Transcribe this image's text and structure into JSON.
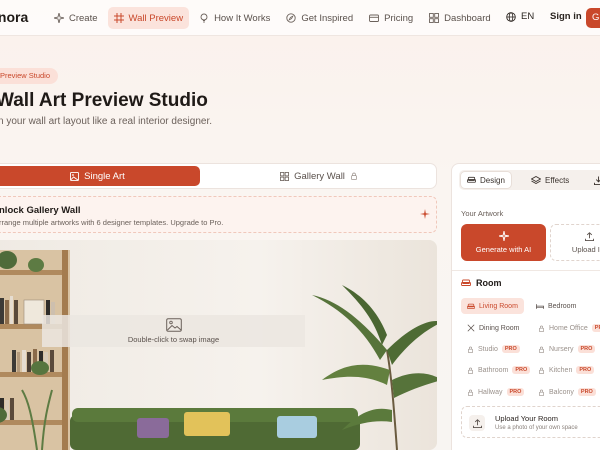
{
  "app": {
    "logo": "Inora"
  },
  "nav": {
    "items": [
      {
        "label": "Create",
        "icon": "sparkle-icon",
        "active": false
      },
      {
        "label": "Wall Preview",
        "icon": "frame-icon",
        "active": true
      },
      {
        "label": "How It Works",
        "icon": "bulb-icon",
        "active": false
      },
      {
        "label": "Get Inspired",
        "icon": "compass-icon",
        "active": false
      },
      {
        "label": "Pricing",
        "icon": "card-icon",
        "active": false
      },
      {
        "label": "Dashboard",
        "icon": "grid-icon",
        "active": false
      }
    ],
    "language": "EN",
    "signin": "Sign in",
    "cta": "G"
  },
  "hero": {
    "badge": "Preview Studio",
    "title": "Wall Art Preview Studio",
    "subtitle": "n your wall art layout like a real interior designer."
  },
  "tabs": {
    "single": "Single Art",
    "gallery": "Gallery Wall"
  },
  "unlock": {
    "title": "nlock Gallery Wall",
    "subtitle": "rrange multiple artworks with 6 designer templates. Upgrade to Pro."
  },
  "preview": {
    "swap_hint": "Double-click to swap image"
  },
  "panel": {
    "tabs": {
      "design": "Design",
      "effects": "Effects"
    },
    "your_artwork": "Your Artwork",
    "generate": "Generate with AI",
    "upload": "Upload Im",
    "room_title": "Room",
    "rooms": [
      {
        "label": "Living Room",
        "active": true,
        "locked": false,
        "pro": false
      },
      {
        "label": "Bedroom",
        "active": false,
        "locked": false,
        "pro": false
      },
      {
        "label": "Dining Room",
        "active": false,
        "locked": false,
        "pro": false
      },
      {
        "label": "Home Office",
        "active": false,
        "locked": true,
        "pro": true
      },
      {
        "label": "Studio",
        "active": false,
        "locked": true,
        "pro": true
      },
      {
        "label": "Nursery",
        "active": false,
        "locked": true,
        "pro": true
      },
      {
        "label": "Bathroom",
        "active": false,
        "locked": true,
        "pro": true
      },
      {
        "label": "Kitchen",
        "active": false,
        "locked": true,
        "pro": true
      },
      {
        "label": "Hallway",
        "active": false,
        "locked": true,
        "pro": true
      },
      {
        "label": "Balcony",
        "active": false,
        "locked": true,
        "pro": true
      }
    ],
    "pro_label": "PRO",
    "upload_room": {
      "title": "Upload Your Room",
      "subtitle": "Use a photo of your own space"
    }
  },
  "colors": {
    "accent": "#c9482b",
    "accent_soft": "#fbe3dc",
    "background": "#faf5f1"
  }
}
